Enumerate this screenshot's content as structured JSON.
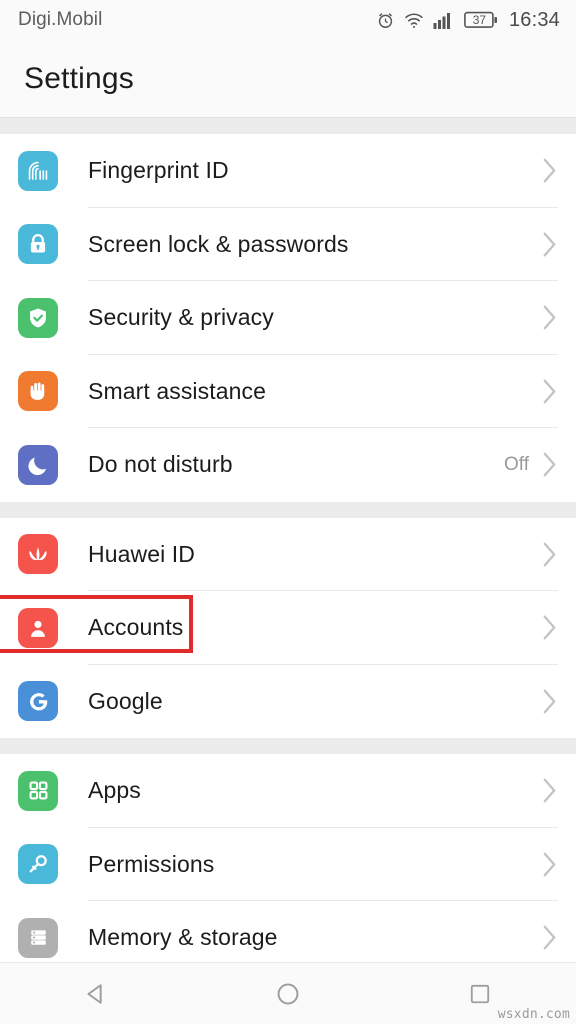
{
  "statusbar": {
    "carrier": "Digi.Mobil",
    "alarm_icon": "alarm-icon",
    "wifi_icon": "wifi-icon",
    "signal_icon": "cellular-signal-icon",
    "battery_icon": "battery-icon",
    "battery_level": "37",
    "clock": "16:34"
  },
  "appbar": {
    "title": "Settings"
  },
  "sections": [
    {
      "name": "security-section",
      "rows": [
        {
          "label": "Fingerprint ID",
          "icon": "fingerprint-icon",
          "icon_color": "#4ab8d8",
          "value": ""
        },
        {
          "label": "Screen lock & passwords",
          "icon": "lock-icon",
          "icon_color": "#4ab8d8",
          "value": ""
        },
        {
          "label": "Security & privacy",
          "icon": "shield-check-icon",
          "icon_color": "#4bc16e",
          "value": ""
        },
        {
          "label": "Smart assistance",
          "icon": "hand-icon",
          "icon_color": "#ef7a30",
          "value": ""
        },
        {
          "label": "Do not disturb",
          "icon": "moon-icon",
          "icon_color": "#5f6fc4",
          "value": "Off"
        }
      ]
    },
    {
      "name": "accounts-section",
      "rows": [
        {
          "label": "Huawei ID",
          "icon": "huawei-flower-icon",
          "icon_color": "#f4544c",
          "value": ""
        },
        {
          "label": "Accounts",
          "icon": "person-circle-icon",
          "icon_color": "#f4544c",
          "value": "",
          "highlighted": true
        },
        {
          "label": "Google",
          "icon": "google-g-icon",
          "icon_color": "#4a90d9",
          "value": ""
        }
      ]
    },
    {
      "name": "apps-section",
      "rows": [
        {
          "label": "Apps",
          "icon": "grid-apps-icon",
          "icon_color": "#4bc16e",
          "value": ""
        },
        {
          "label": "Permissions",
          "icon": "key-icon",
          "icon_color": "#4ab8d8",
          "value": ""
        },
        {
          "label": "Memory & storage",
          "icon": "storage-icon",
          "icon_color": "#b0b0b0",
          "value": ""
        }
      ]
    }
  ],
  "navbar": {
    "back": "back-triangle-icon",
    "home": "home-circle-icon",
    "recents": "recents-square-icon"
  },
  "watermark": "wsxdn.com",
  "colors": {
    "highlight": "#e02b2b",
    "background": "#ececec",
    "card": "#ffffff"
  }
}
